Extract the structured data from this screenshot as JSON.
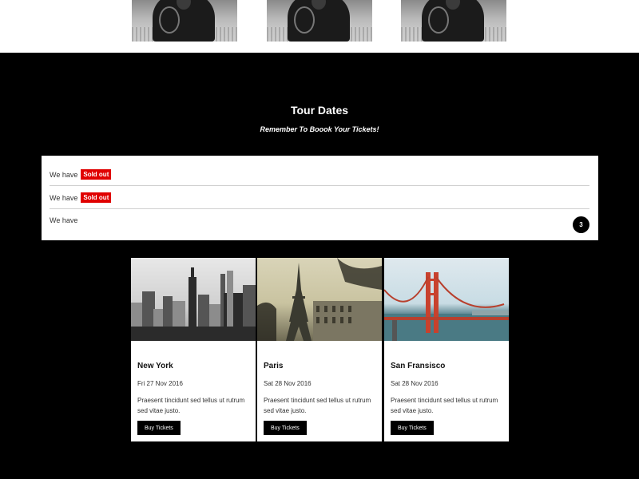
{
  "tour": {
    "title": "Tour Dates",
    "subtitle": "Remember To Boook Your Tickets!"
  },
  "list": {
    "items": [
      {
        "text": "We have",
        "badge": "Sold out"
      },
      {
        "text": "We have",
        "badge": "Sold out"
      },
      {
        "text": "We have",
        "count": "3"
      }
    ]
  },
  "cards": [
    {
      "city": "New York",
      "date": "Fri 27 Nov 2016",
      "description": "Praesent tincidunt sed tellus ut rutrum sed vitae justo.",
      "button": "Buy Tickets"
    },
    {
      "city": "Paris",
      "date": "Sat 28 Nov 2016",
      "description": "Praesent tincidunt sed tellus ut rutrum sed vitae justo.",
      "button": "Buy Tickets"
    },
    {
      "city": "San Fransisco",
      "date": "Sat 28 Nov 2016",
      "description": "Praesent tincidunt sed tellus ut rutrum sed vitae justo.",
      "button": "Buy Tickets"
    }
  ],
  "colors": {
    "sold_out": "#e00000",
    "background": "#000000"
  }
}
